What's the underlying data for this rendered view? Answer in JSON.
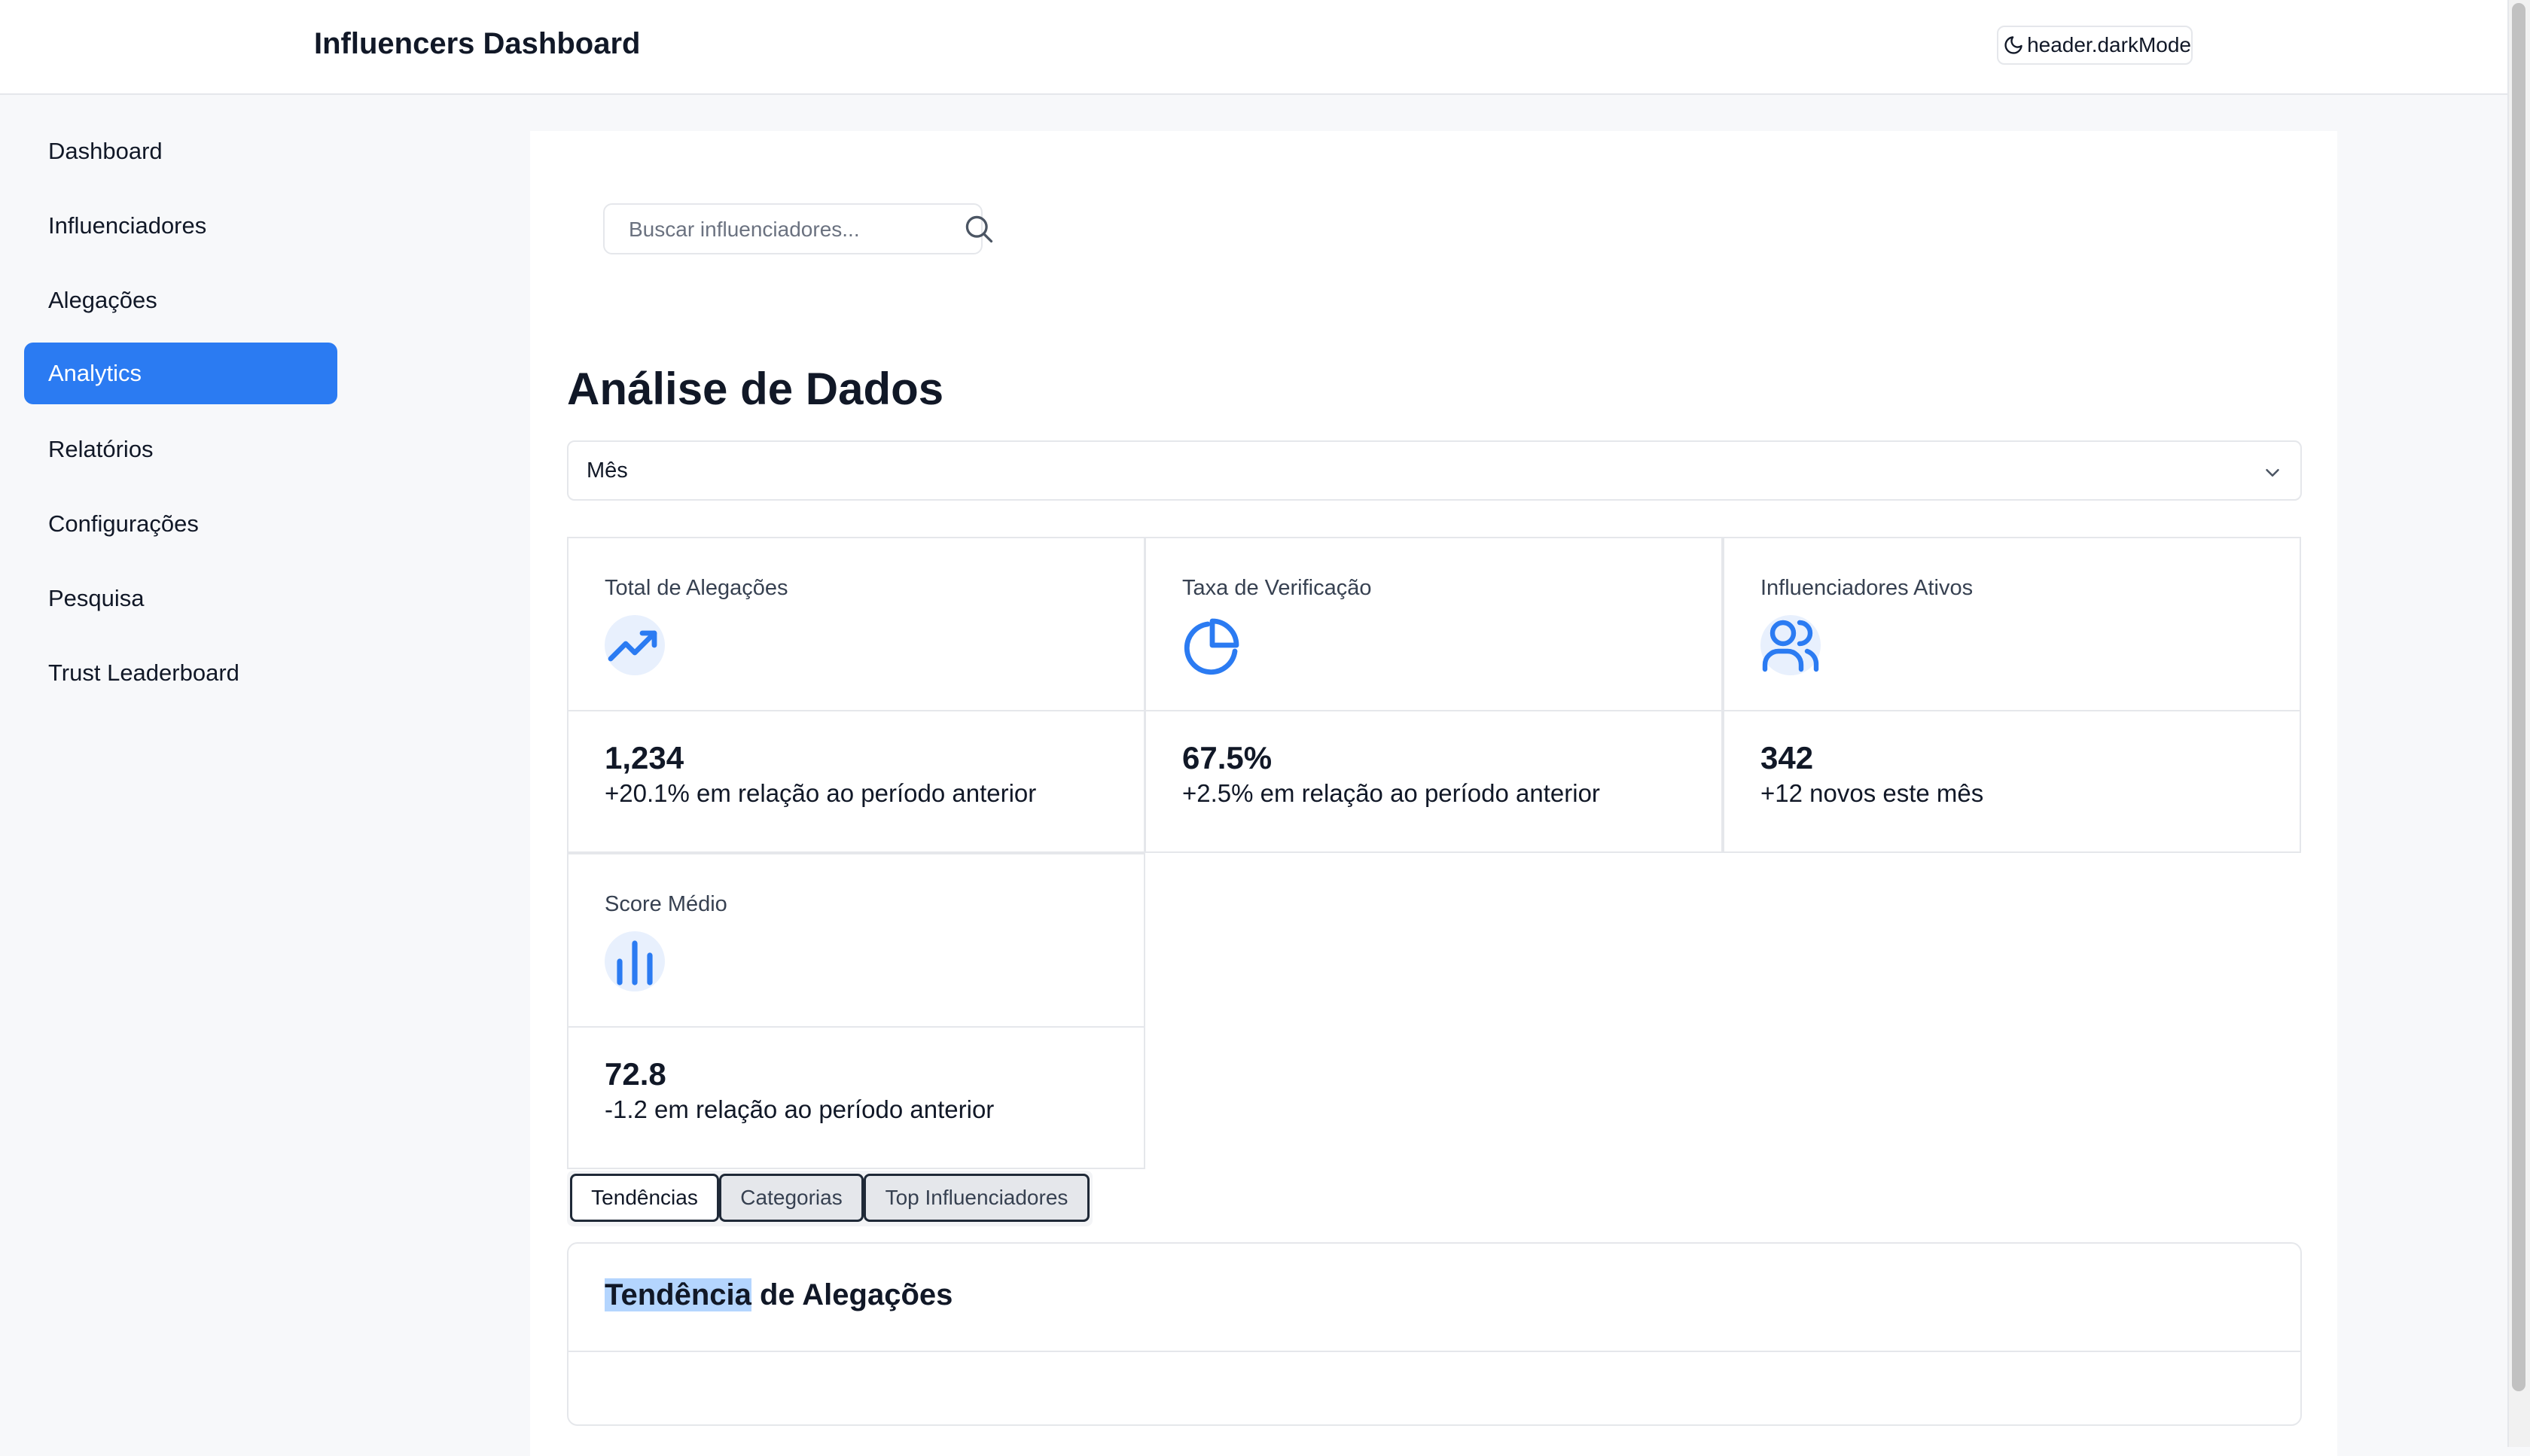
{
  "header": {
    "title": "Influencers Dashboard",
    "dark_mode_label": "header.darkMode"
  },
  "sidebar": {
    "items": [
      {
        "label": "Dashboard",
        "active": false
      },
      {
        "label": "Influenciadores",
        "active": false
      },
      {
        "label": "Alegações",
        "active": false
      },
      {
        "label": "Analytics",
        "active": true
      },
      {
        "label": "Relatórios",
        "active": false
      },
      {
        "label": "Configurações",
        "active": false
      },
      {
        "label": "Pesquisa",
        "active": false
      },
      {
        "label": "Trust Leaderboard",
        "active": false
      }
    ]
  },
  "search": {
    "placeholder": "Buscar influenciadores...",
    "value": ""
  },
  "main": {
    "title": "Análise de Dados",
    "period": "Mês",
    "cards": [
      {
        "label": "Total de Alegações",
        "icon": "trending-up-icon",
        "value": "1,234",
        "delta": "+20.1% em relação ao período anterior"
      },
      {
        "label": "Taxa de Verificação",
        "icon": "pie-chart-icon",
        "value": "67.5%",
        "delta": "+2.5% em relação ao período anterior"
      },
      {
        "label": "Influenciadores Ativos",
        "icon": "users-icon",
        "value": "342",
        "delta": "+12 novos este mês"
      },
      {
        "label": "Score Médio",
        "icon": "bar-chart-icon",
        "value": "72.8",
        "delta": "-1.2 em relação ao período anterior"
      }
    ],
    "tabs": [
      {
        "label": "Tendências",
        "active": true
      },
      {
        "label": "Categorias",
        "active": false
      },
      {
        "label": "Top Influenciadores",
        "active": false
      }
    ],
    "trend": {
      "title_highlight": "Tendência",
      "title_rest": " de Alegações"
    }
  },
  "colors": {
    "accent": "#2b7bf2",
    "icon_bg": "#e8f0fd",
    "border": "#e5e7eb",
    "background": "#f7f8fa"
  }
}
